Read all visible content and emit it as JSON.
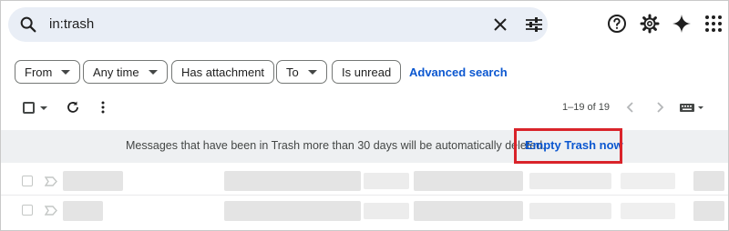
{
  "search": {
    "query": "in:trash",
    "icons": {
      "search": "search-icon",
      "clear": "close-icon",
      "options": "tune-icon"
    }
  },
  "header_icons": [
    "help-icon",
    "settings-gear-icon",
    "gemini-sparkle-icon",
    "apps-grid-icon"
  ],
  "filters": {
    "chips": [
      {
        "label": "From",
        "dropdown": true
      },
      {
        "label": "Any time",
        "dropdown": true
      },
      {
        "label": "Has attachment",
        "dropdown": false
      },
      {
        "label": "To",
        "dropdown": true
      },
      {
        "label": "Is unread",
        "dropdown": false
      }
    ],
    "advanced_search": "Advanced search"
  },
  "toolbar": {
    "pagination": "1–19 of 19",
    "icons": [
      "select-all-checkbox",
      "refresh-icon",
      "more-vert-icon",
      "chevron-left-icon",
      "chevron-right-icon",
      "keyboard-icon"
    ]
  },
  "banner": {
    "message": "Messages that have been in Trash more than 30 days will be automatically deleted.",
    "action": "Empty Trash now"
  },
  "colors": {
    "search_bg": "#e9eef6",
    "link_blue": "#0b57d0",
    "banner_bg": "#eef0f2",
    "highlight_red": "#d9232a"
  }
}
